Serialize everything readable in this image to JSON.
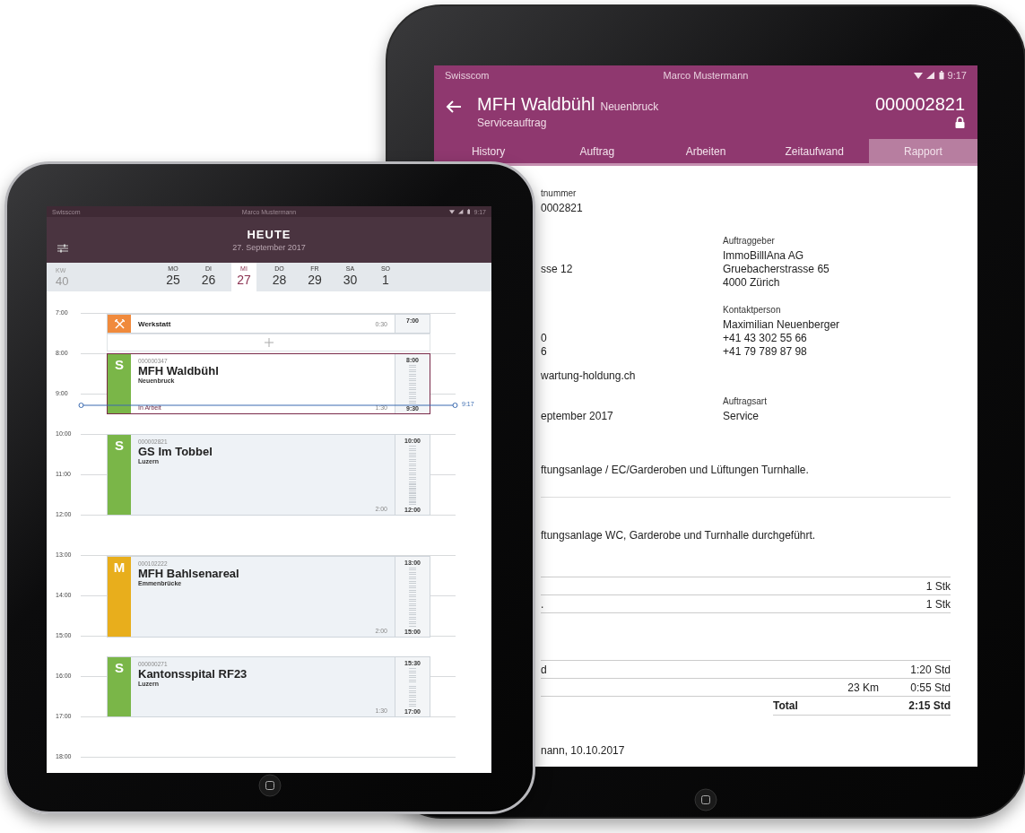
{
  "back_tablet": {
    "status_bar": {
      "carrier": "Swisscom",
      "user": "Marco Mustermann",
      "time": "9:17"
    },
    "header": {
      "title": "MFH Waldbühl",
      "place": "Neuenbruck",
      "subtitle": "Serviceauftrag",
      "order_number": "000002821",
      "locked": true
    },
    "tabs": [
      {
        "label": "History",
        "selected": false
      },
      {
        "label": "Auftrag",
        "selected": false
      },
      {
        "label": "Arbeiten",
        "selected": false
      },
      {
        "label": "Zeitaufwand",
        "selected": false
      },
      {
        "label": "Rapport",
        "selected": true
      }
    ],
    "report": {
      "order_number": {
        "label": "tnummer",
        "value": "0002821"
      },
      "address_line": "sse 12",
      "client": {
        "label": "Auftraggeber",
        "lines": [
          "ImmoBilllAna AG",
          "Gruebacherstrasse 65",
          "4000 Zürich"
        ]
      },
      "contact": {
        "label": "Kontaktperson",
        "lines": [
          "Maximilian Neuenberger",
          "+41 43 302 55 66",
          "+41 79 789 87 98"
        ]
      },
      "phone_fragments": [
        "0",
        "6"
      ],
      "email": "wartung-holdung.ch",
      "order_type": {
        "label": "Auftragsart",
        "value": "Service"
      },
      "date": "eptember 2017",
      "description": "ftungsanlage / EC/Garderoben und Lüftungen Turnhalle.",
      "work_done": "ftungsanlage WC, Garderobe und Turnhalle durchgeführt.",
      "materials": [
        {
          "qty": "1 Stk"
        },
        {
          "item": ".",
          "qty": "1 Stk"
        }
      ],
      "time_rows": [
        {
          "label": "d",
          "time": "1:20 Std"
        },
        {
          "distance": "23 Km",
          "time": "0:55 Std"
        }
      ],
      "total": {
        "label": "Total",
        "value": "2:15 Std"
      },
      "signature": "nann, 10.10.2017"
    }
  },
  "front_tablet": {
    "status_bar": {
      "carrier": "Swisscom",
      "user": "Marco Mustermann",
      "time": "9:17"
    },
    "header": {
      "title": "HEUTE",
      "date": "27. September 2017"
    },
    "week": {
      "label": "KW",
      "number": "40",
      "days": [
        {
          "weekday": "MO",
          "day": "25",
          "selected": false
        },
        {
          "weekday": "DI",
          "day": "26",
          "selected": false
        },
        {
          "weekday": "MI",
          "day": "27",
          "selected": true
        },
        {
          "weekday": "DO",
          "day": "28",
          "selected": false
        },
        {
          "weekday": "FR",
          "day": "29",
          "selected": false
        },
        {
          "weekday": "SA",
          "day": "30",
          "selected": false
        },
        {
          "weekday": "SO",
          "day": "1",
          "selected": false
        }
      ]
    },
    "hours": [
      "7:00",
      "8:00",
      "9:00",
      "10:00",
      "11:00",
      "12:00",
      "13:00",
      "14:00",
      "15:00",
      "16:00",
      "17:00",
      "18:00"
    ],
    "events": [
      {
        "kind": "workshop",
        "color": "#f08a3c",
        "title": "Werkstatt",
        "duration": "0:30",
        "start": "7:00",
        "selected": false
      },
      {
        "kind": "service",
        "color": "#7ab648",
        "badge": "S",
        "number": "000000347",
        "title": "MFH Waldbühl",
        "place": "Neuenbruck",
        "status": "In Arbeit",
        "duration": "1:30",
        "start": "8:00",
        "end": "9:30",
        "selected": true
      },
      {
        "kind": "service",
        "color": "#7ab648",
        "badge": "S",
        "number": "000002821",
        "title": "GS Im Tobbel",
        "place": "Luzern",
        "duration": "2:00",
        "start": "10:00",
        "end": "12:00",
        "selected": false
      },
      {
        "kind": "service",
        "color": "#e8ae1c",
        "badge": "M",
        "number": "000102222",
        "title": "MFH Bahlsenareal",
        "place": "Emmenbrücke",
        "duration": "2:00",
        "start": "13:00",
        "end": "15:00",
        "selected": false
      },
      {
        "kind": "service",
        "color": "#7ab648",
        "badge": "S",
        "number": "000000271",
        "title": "Kantonsspital RF23",
        "place": "Luzern",
        "duration": "1:30",
        "start": "15:30",
        "end": "17:00",
        "selected": false
      }
    ],
    "now": {
      "time": "9:17"
    }
  }
}
